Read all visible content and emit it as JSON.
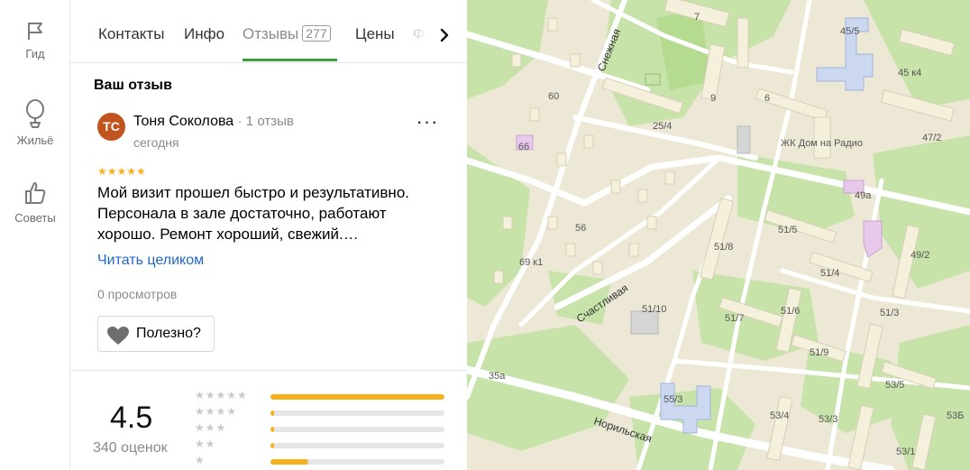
{
  "rail": {
    "items": [
      {
        "label": "Гид",
        "icon": "flag-icon"
      },
      {
        "label": "Жильё",
        "icon": "balloon-icon"
      },
      {
        "label": "Советы",
        "icon": "thumbs-up-icon"
      }
    ]
  },
  "tabs": {
    "items": [
      "Контакты",
      "Инфо",
      "Отзывы",
      "Цены",
      "Ф"
    ],
    "reviews_count": "277",
    "active": "Отзывы"
  },
  "review": {
    "section_title": "Ваш отзыв",
    "avatar_initials": "ТС",
    "author": "Тоня Соколова",
    "author_reviews": "· 1 отзыв",
    "date": "сегодня",
    "more": "···",
    "stars": "★★★★★",
    "rating": 5,
    "text": "Мой визит прошел быстро и результативно. Персонала в зале достаточно, работают хорошо. Ремонт хороший, свежий.…",
    "read_more": "Читать целиком",
    "views": "0 просмотров",
    "helpful_label": "Полезно?"
  },
  "summary": {
    "rating": "4.5",
    "count": "340 оценок",
    "distribution": [
      {
        "stars": "★★★★★",
        "fraction": 1.0
      },
      {
        "stars": "★★★★",
        "fraction": 0.02
      },
      {
        "stars": "★★★",
        "fraction": 0.02
      },
      {
        "stars": "★★",
        "fraction": 0.02
      },
      {
        "stars": "★",
        "fraction": 0.22
      }
    ]
  },
  "map": {
    "streets": [
      "Снежная",
      "Счастливая",
      "Норильская"
    ],
    "labels": [
      "7",
      "45/5",
      "45 к4",
      "60",
      "9",
      "6",
      "25/4",
      "47/2",
      "66",
      "ЖК Дом на Радио",
      "49а",
      "56",
      "51/5",
      "51/8",
      "49/2",
      "69 к1",
      "51/4",
      "51/10",
      "51/6",
      "51/3",
      "51/7",
      "51/9",
      "35а",
      "55/3",
      "53/5",
      "53/4",
      "53/3",
      "53Б",
      "53/1"
    ],
    "colors": {
      "land": "#ede8d6",
      "park": "#c7e3a9",
      "road": "#ffffff",
      "building": "#f5f0dc",
      "accent": "#cbd8f0",
      "lilac": "#e8c9ec"
    }
  }
}
